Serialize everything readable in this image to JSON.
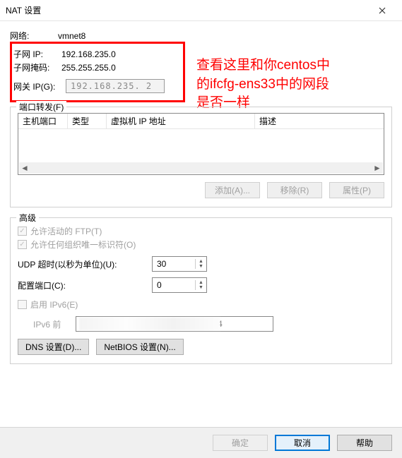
{
  "window": {
    "title": "NAT 设置"
  },
  "network": {
    "label": "网络:",
    "value": "vmnet8"
  },
  "subnet_ip": {
    "label": "子网 IP:",
    "value": "192.168.235.0"
  },
  "subnet_mask": {
    "label": "子网掩码:",
    "value": "255.255.255.0"
  },
  "gateway": {
    "label": "网关 IP(G):",
    "value": "192.168.235. 2"
  },
  "annotation": {
    "line1": "查看这里和你centos中",
    "line2": "的ifcfg-ens33中的网段",
    "line3": "是否一样"
  },
  "port_forward": {
    "legend": "端口转发(F)",
    "cols": [
      "主机端口",
      "类型",
      "虚拟机 IP 地址",
      "描述"
    ],
    "buttons": {
      "add": "添加(A)...",
      "remove": "移除(R)",
      "props": "属性(P)"
    }
  },
  "advanced": {
    "legend": "高级",
    "allow_ftp": "允许活动的 FTP(T)",
    "allow_oui": "允许任何组织唯一标识符(O)",
    "udp_timeout_label": "UDP 超时(以秒为单位)(U):",
    "udp_timeout_value": "30",
    "config_port_label": "配置端口(C):",
    "config_port_value": "0",
    "enable_ipv6": "启用 IPv6(E)",
    "ipv6_prefix_label": "IPv6 前",
    "ipv6_prefix_tail": "4",
    "dns_btn": "DNS 设置(D)...",
    "netbios_btn": "NetBIOS 设置(N)..."
  },
  "footer": {
    "ok": "确定",
    "cancel": "取消",
    "help": "帮助"
  }
}
